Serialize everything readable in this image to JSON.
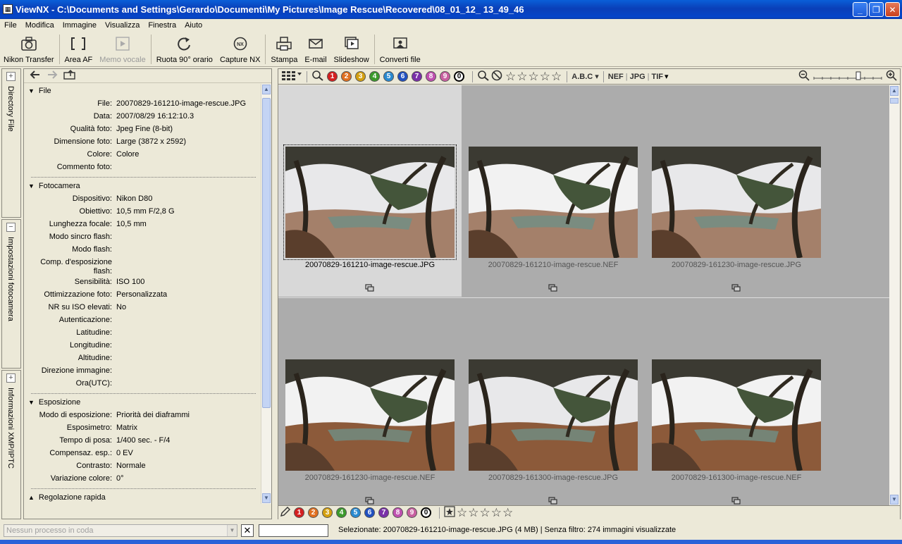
{
  "window": {
    "title": "ViewNX - C:\\Documents and Settings\\Gerardo\\Documenti\\My Pictures\\Image Rescue\\Recovered\\08_01_12_ 13_49_46"
  },
  "menu": [
    "File",
    "Modifica",
    "Immagine",
    "Visualizza",
    "Finestra",
    "Aiuto"
  ],
  "toolbar": {
    "nikon_transfer": "Nikon Transfer",
    "area_af": "Area AF",
    "memo_vocale": "Memo vocale",
    "ruota": "Ruota 90° orario",
    "capture_nx": "Capture NX",
    "stampa": "Stampa",
    "email": "E-mail",
    "slideshow": "Slideshow",
    "converti": "Converti file"
  },
  "vtabs": {
    "directory": "Directory File",
    "impostazioni": "Impostazioni fotocamera",
    "xmp": "Informazioni XMP/IPTC"
  },
  "metadata": {
    "file": {
      "title": "File",
      "rows": [
        {
          "k": "File:",
          "v": "20070829-161210-image-rescue.JPG"
        },
        {
          "k": "Data:",
          "v": "2007/08/29 16:12:10.3"
        },
        {
          "k": "Qualità foto:",
          "v": "Jpeg Fine (8-bit)"
        },
        {
          "k": "Dimensione foto:",
          "v": "Large (3872 x 2592)"
        },
        {
          "k": "Colore:",
          "v": "Colore"
        },
        {
          "k": "Commento foto:",
          "v": ""
        }
      ]
    },
    "fotocamera": {
      "title": "Fotocamera",
      "rows": [
        {
          "k": "Dispositivo:",
          "v": "Nikon D80"
        },
        {
          "k": "Obiettivo:",
          "v": "10,5 mm F/2,8 G"
        },
        {
          "k": "Lunghezza focale:",
          "v": "10,5 mm"
        },
        {
          "k": "Modo sincro flash:",
          "v": ""
        },
        {
          "k": "Modo flash:",
          "v": ""
        },
        {
          "k": "Comp. d'esposizione flash:",
          "v": ""
        },
        {
          "k": "Sensibilità:",
          "v": "ISO 100"
        },
        {
          "k": "Ottimizzazione foto:",
          "v": "Personalizzata"
        },
        {
          "k": "NR su ISO elevati:",
          "v": "No"
        },
        {
          "k": "Autenticazione:",
          "v": ""
        },
        {
          "k": "Latitudine:",
          "v": ""
        },
        {
          "k": "Longitudine:",
          "v": ""
        },
        {
          "k": "Altitudine:",
          "v": ""
        },
        {
          "k": "Direzione immagine:",
          "v": ""
        },
        {
          "k": "Ora(UTC):",
          "v": ""
        }
      ]
    },
    "esposizione": {
      "title": "Esposizione",
      "rows": [
        {
          "k": "Modo di esposizione:",
          "v": "Priorità dei diaframmi"
        },
        {
          "k": "Esposimetro:",
          "v": "Matrix"
        },
        {
          "k": "Tempo di posa:",
          "v": "1/400 sec. - F/4"
        },
        {
          "k": "Compensaz. esp.:",
          "v": "0 EV"
        },
        {
          "k": "Contrasto:",
          "v": "Normale"
        },
        {
          "k": "Variazione colore:",
          "v": "0°"
        }
      ]
    },
    "regolazione": {
      "title": "Regolazione rapida"
    }
  },
  "filterbar": {
    "labels": [
      "1",
      "2",
      "3",
      "4",
      "5",
      "6",
      "7",
      "8",
      "9",
      "0"
    ],
    "label_colors": [
      "#d42020",
      "#e07020",
      "#d4a010",
      "#3c9a2c",
      "#2a8ad0",
      "#2050c0",
      "#7a30a8",
      "#c050b0",
      "#c860a0",
      "#ffffff"
    ],
    "name_sort": "A.B.C",
    "formats": [
      "NEF",
      "JPG",
      "TIF"
    ]
  },
  "thumbnails": [
    {
      "name": "20070829-161210-image-rescue.JPG",
      "selected": true
    },
    {
      "name": "20070829-161210-image-rescue.NEF",
      "selected": false
    },
    {
      "name": "20070829-161230-image-rescue.JPG",
      "selected": false
    },
    {
      "name": "20070829-161230-image-rescue.NEF",
      "selected": false
    },
    {
      "name": "20070829-161300-image-rescue.JPG",
      "selected": false
    },
    {
      "name": "20070829-161300-image-rescue.NEF",
      "selected": false
    }
  ],
  "status": {
    "queue_placeholder": "Nessun processo in coda",
    "selection_text": "Selezionate: 20070829-161210-image-rescue.JPG (4 MB) | Senza filtro: 274 immagini visualizzate"
  }
}
